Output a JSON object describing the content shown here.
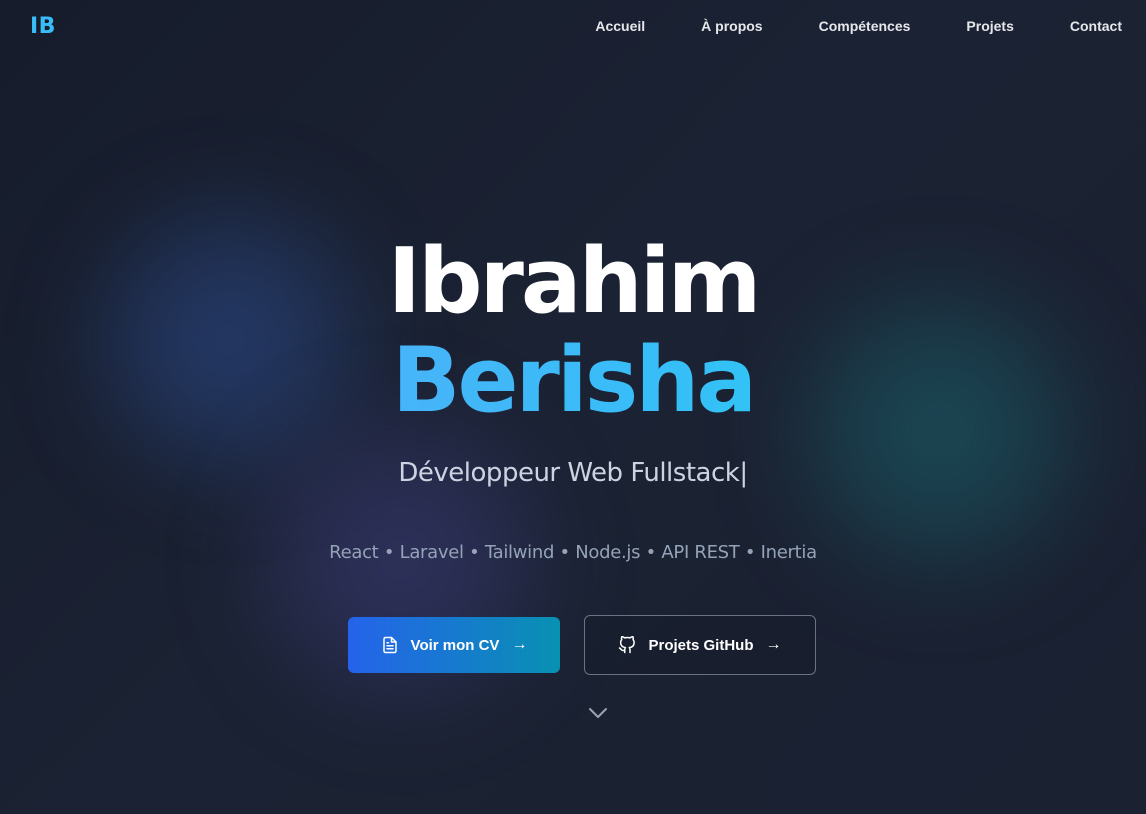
{
  "nav": {
    "logo": "IB",
    "links": [
      {
        "label": "Accueil"
      },
      {
        "label": "À propos"
      },
      {
        "label": "Compétences"
      },
      {
        "label": "Projets"
      },
      {
        "label": "Contact"
      }
    ]
  },
  "hero": {
    "first_name": "Ibrahim",
    "last_name": "Berisha",
    "subtitle": "Développeur Web Fullstack",
    "cursor": "|",
    "tech_stack": "React • Laravel • Tailwind • Node.js • API REST • Inertia",
    "buttons": {
      "cv_label": "Voir mon CV",
      "cv_arrow": "→",
      "cv_icon": "document-icon",
      "github_label": "Projets GitHub",
      "github_arrow": "→",
      "github_icon": "github-icon"
    },
    "scroll_icon": "chevron-down-icon"
  },
  "colors": {
    "accent": "#38bdf8",
    "gradient_start": "#60a5fa",
    "gradient_end": "#22d3ee",
    "button_start": "#2563eb",
    "button_end": "#0891b2",
    "background": "#1b2233"
  }
}
